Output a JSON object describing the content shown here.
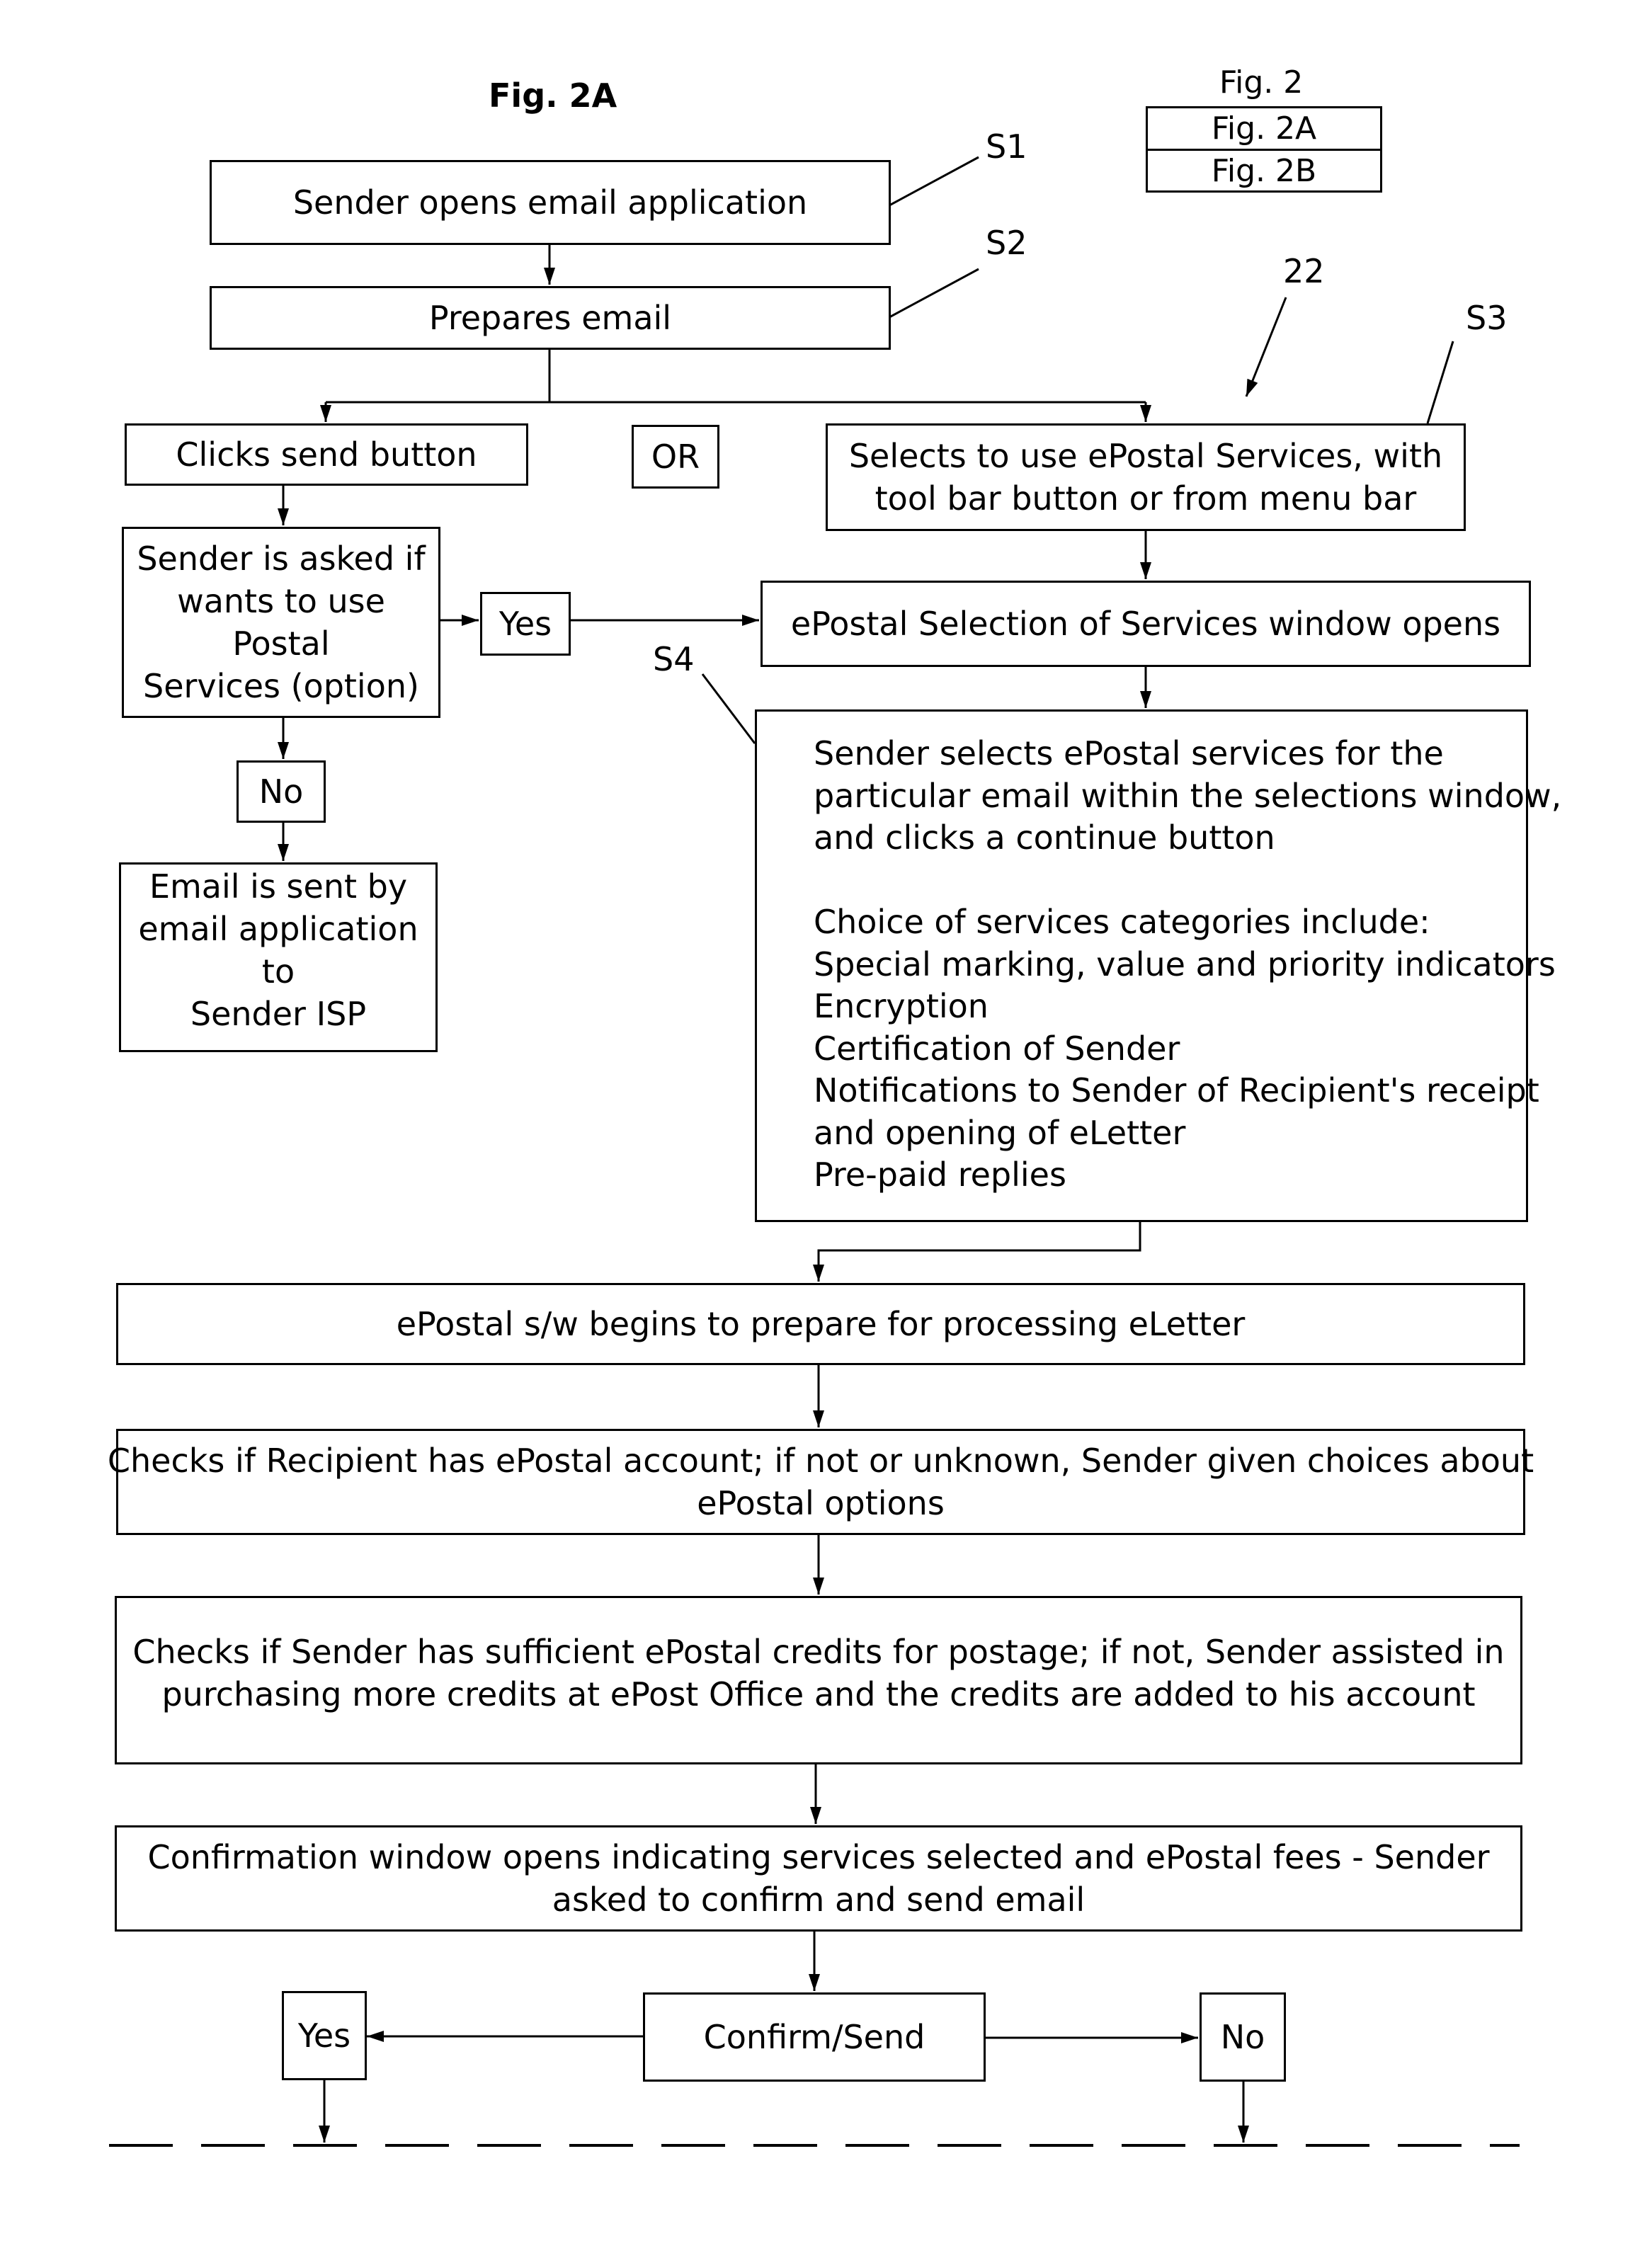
{
  "figure": {
    "title": "Fig. 2A",
    "legend": {
      "heading": "Fig. 2",
      "cells": [
        "Fig. 2A",
        "Fig. 2B"
      ]
    }
  },
  "reference_labels": {
    "s1": "S1",
    "s2": "S2",
    "s3": "S3",
    "s4": "S4",
    "ref22": "22"
  },
  "nodes": {
    "open_app": "Sender opens email application",
    "prepare": "Prepares email",
    "click_send": "Clicks send button",
    "or": "OR",
    "select_epostal": [
      "Selects to use ePostal Services, with",
      "tool bar button or from menu bar"
    ],
    "asked": [
      "Sender is asked if",
      "wants to use Postal",
      "Services (option)"
    ],
    "yes_top": "Yes",
    "no_left": "No",
    "email_sent": [
      "Email is sent by",
      "email application to",
      "Sender ISP"
    ],
    "selection_window": "ePostal Selection of Services window opens",
    "select_services": {
      "intro": [
        "Sender selects ePostal services for the",
        "particular email within the selections window,",
        "and clicks a continue button"
      ],
      "heading": "Choice of services categories include:",
      "categories": [
        "Special marking, value and priority indicators",
        "Encryption",
        "Certification of Sender",
        "Notifications to Sender of Recipient's receipt",
        "and opening of eLetter",
        "Pre-paid replies"
      ]
    },
    "prepare_processing": "ePostal s/w begins to prepare for processing eLetter",
    "check_recipient": [
      "Checks if Recipient has ePostal account;  if not or unknown, Sender given choices about",
      "ePostal options"
    ],
    "check_credits": [
      "Checks if Sender has sufficient ePostal credits for postage;  if not, Sender assisted in",
      "purchasing more credits at ePost Office and the credits are added  to his account"
    ],
    "confirmation": [
      "Confirmation window opens indicating services selected and ePostal fees -  Sender",
      "asked to confirm and send email"
    ],
    "confirm_send": "Confirm/Send",
    "yes_bottom": "Yes",
    "no_bottom": "No"
  }
}
